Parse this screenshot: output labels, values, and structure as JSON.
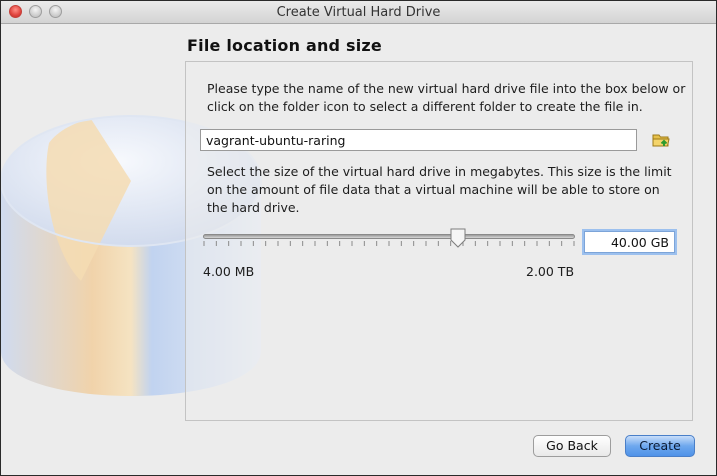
{
  "window": {
    "title": "Create Virtual Hard Drive"
  },
  "page": {
    "heading": "File location and size"
  },
  "location": {
    "description": "Please type the name of the new virtual hard drive file into the box below or click on the folder icon to select a different folder to create the file in.",
    "file_name": "vagrant-ubuntu-raring",
    "folder_icon": "folder-browse-icon"
  },
  "size": {
    "description": "Select the size of the virtual hard drive in megabytes. This size is the limit on the amount of file data that a virtual machine will be able to store on the hard drive.",
    "value": "40.00 GB",
    "min_label": "4.00 MB",
    "max_label": "2.00 TB",
    "slider_fraction": 0.685
  },
  "buttons": {
    "back": "Go Back",
    "create": "Create"
  },
  "colors": {
    "accent": "#4f92e8",
    "focus_ring": "#9cc0ee"
  }
}
